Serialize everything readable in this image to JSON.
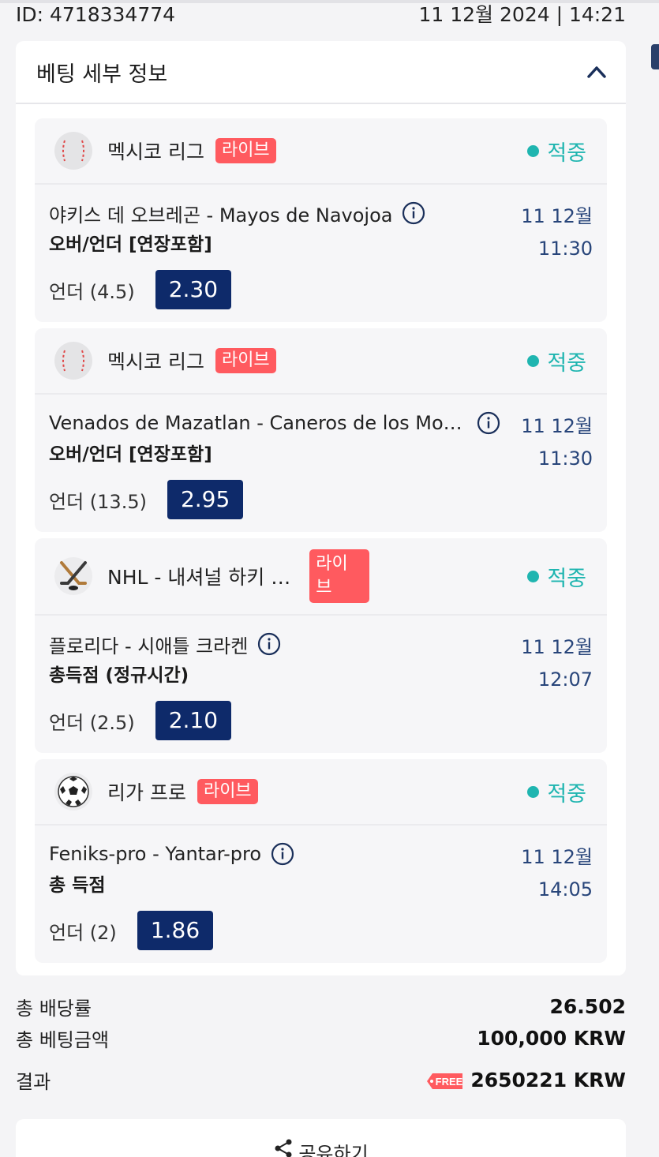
{
  "header": {
    "id_text": "ID: 4718334774",
    "datetime": "11 12월 2024 | 14:21"
  },
  "card": {
    "title": "베팅 세부 정보"
  },
  "bets": [
    {
      "sport_icon": "baseball-icon",
      "league": "멕시코 리그",
      "live_label": "라이브",
      "status": "적중",
      "match": "야키스 데 오브레곤 - Mayos de Navojoa",
      "market": "오버/언더 [연장포함]",
      "pick": "언더 (4.5)",
      "odds": "2.30",
      "date": "11 12월",
      "time": "11:30"
    },
    {
      "sport_icon": "baseball-icon",
      "league": "멕시코 리그",
      "live_label": "라이브",
      "status": "적중",
      "match": "Venados de Mazatlan - Caneros de los Mo…",
      "market": "오버/언더 [연장포함]",
      "pick": "언더 (13.5)",
      "odds": "2.95",
      "date": "11 12월",
      "time": "11:30"
    },
    {
      "sport_icon": "hockey-icon",
      "league": "NHL - 내셔널 하키 …",
      "live_label_1": "라이",
      "live_label_2": "브",
      "status": "적중",
      "match": "플로리다 - 시애틀 크라켄",
      "market": "총득점 (정규시간)",
      "pick": "언더 (2.5)",
      "odds": "2.10",
      "date": "11 12월",
      "time": "12:07"
    },
    {
      "sport_icon": "soccer-icon",
      "league": "리가 프로",
      "live_label": "라이브",
      "status": "적중",
      "match": "Feniks-pro - Yantar-pro",
      "market": "총 득점",
      "pick": "언더 (2)",
      "odds": "1.86",
      "date": "11 12월",
      "time": "14:05"
    }
  ],
  "summary": {
    "total_odds_label": "총 배당률",
    "total_odds_value": "26.502",
    "total_stake_label": "총 베팅금액",
    "total_stake_value": "100,000 KRW",
    "result_label": "결과",
    "result_tag": "FREE",
    "result_value": "2650221 KRW"
  },
  "share": {
    "label": "공유하기"
  },
  "colors": {
    "accent_navy": "#0e2a6a",
    "live_red": "#ff5a5f",
    "win_teal": "#1fb5b0"
  }
}
